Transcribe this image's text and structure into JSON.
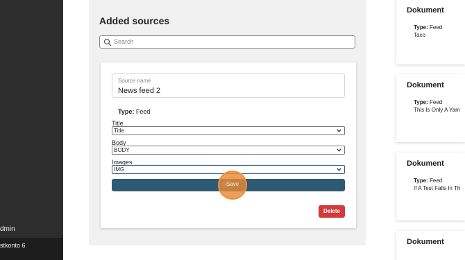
{
  "sidebar": {
    "items": [
      {
        "label": "dmin"
      },
      {
        "label": "stkonto 6"
      }
    ]
  },
  "panel": {
    "title": "Added sources",
    "search": {
      "placeholder": "Search"
    }
  },
  "source_card": {
    "name_label": "Source name",
    "name_value": "News feed 2",
    "type_label": "Type:",
    "type_value": "Feed",
    "fields": [
      {
        "label": "Title",
        "value": "Title"
      },
      {
        "label": "Body",
        "value": "BODY"
      },
      {
        "label": "Images",
        "value": "IMG"
      }
    ],
    "save_label": "Save",
    "delete_label": "Delete"
  },
  "documents": [
    {
      "title": "Dokument",
      "type_label": "Type:",
      "type_value": "Feed",
      "description": "Taco"
    },
    {
      "title": "Dokument",
      "type_label": "Type:",
      "type_value": "Feed",
      "description": "This Is Only A Yam"
    },
    {
      "title": "Dokument",
      "type_label": "Type:",
      "type_value": "Feed",
      "description": "If A Test Falls In Th"
    },
    {
      "title": "Dokument"
    }
  ],
  "colors": {
    "sidebar": "#2d2d2d",
    "save_button": "#2e5a73",
    "delete_button": "#d33a3a",
    "click_highlight": "#e88a37"
  }
}
